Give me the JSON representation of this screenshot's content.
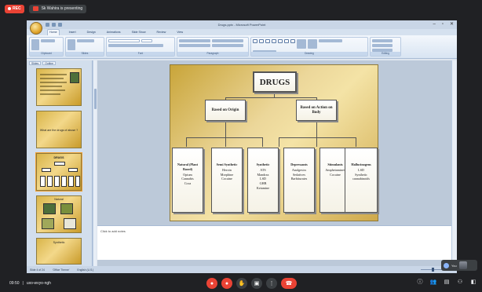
{
  "meet": {
    "rec_label": "REC",
    "presenting_text": "Sk Wahira is presenting",
    "time": "09:50",
    "meeting_code": "uxo-wvyo-ngh",
    "self_label": "You"
  },
  "ppt": {
    "doc_title": "Drugs.pptx - Microsoft PowerPoint",
    "window_controls": [
      "–",
      "▫",
      "✕"
    ],
    "ribbon_tabs": [
      "Home",
      "Insert",
      "Design",
      "Animations",
      "Slide Show",
      "Review",
      "View"
    ],
    "ribbon_groups": [
      "Clipboard",
      "Slides",
      "Font",
      "Paragraph",
      "Drawing",
      "Editing"
    ],
    "pane_tabs": [
      "Slides",
      "Outline"
    ],
    "thumbnails": [
      {
        "num": "",
        "caption": ""
      },
      {
        "num": "",
        "caption": "What are the drugs of abuse ?"
      },
      {
        "num": "",
        "caption": "DRUGS"
      },
      {
        "num": "",
        "caption": "Natural"
      },
      {
        "num": "",
        "caption": "Synthetic"
      }
    ],
    "notes_placeholder": "Click to add notes",
    "status": {
      "slide_info": "Slide 4 of 24",
      "theme": "'Office Theme'",
      "language": "English (U.S.)"
    }
  },
  "slide": {
    "title": "DRUGS",
    "categories": {
      "left": "Based on Origin",
      "right": "Based on Action on Body"
    },
    "leaves": [
      {
        "title": "Natural (Plant Based)",
        "items": [
          "Opium",
          "Cannabis",
          "Coca"
        ]
      },
      {
        "title": "Semi Synthetic",
        "items": [
          "Heroin",
          "Morphine",
          "Cocaine"
        ]
      },
      {
        "title": "Synthetic",
        "items": [
          "ATS",
          "Mandrax",
          "LSD",
          "GHB",
          "Ketamine"
        ]
      },
      {
        "title": "Depressants",
        "items": [
          "Analgesics",
          "Sedatives",
          "Barbiturates"
        ]
      },
      {
        "title": "Stimulants",
        "items": [
          "Amphetamines",
          "Cocaine"
        ]
      },
      {
        "title": "Hallucinogens",
        "items": [
          "LSD",
          "Synthetic cannabinoids"
        ]
      }
    ]
  },
  "controls": {
    "buttons": [
      "mic-off",
      "cam-off",
      "hand",
      "present",
      "more",
      "hangup"
    ]
  }
}
